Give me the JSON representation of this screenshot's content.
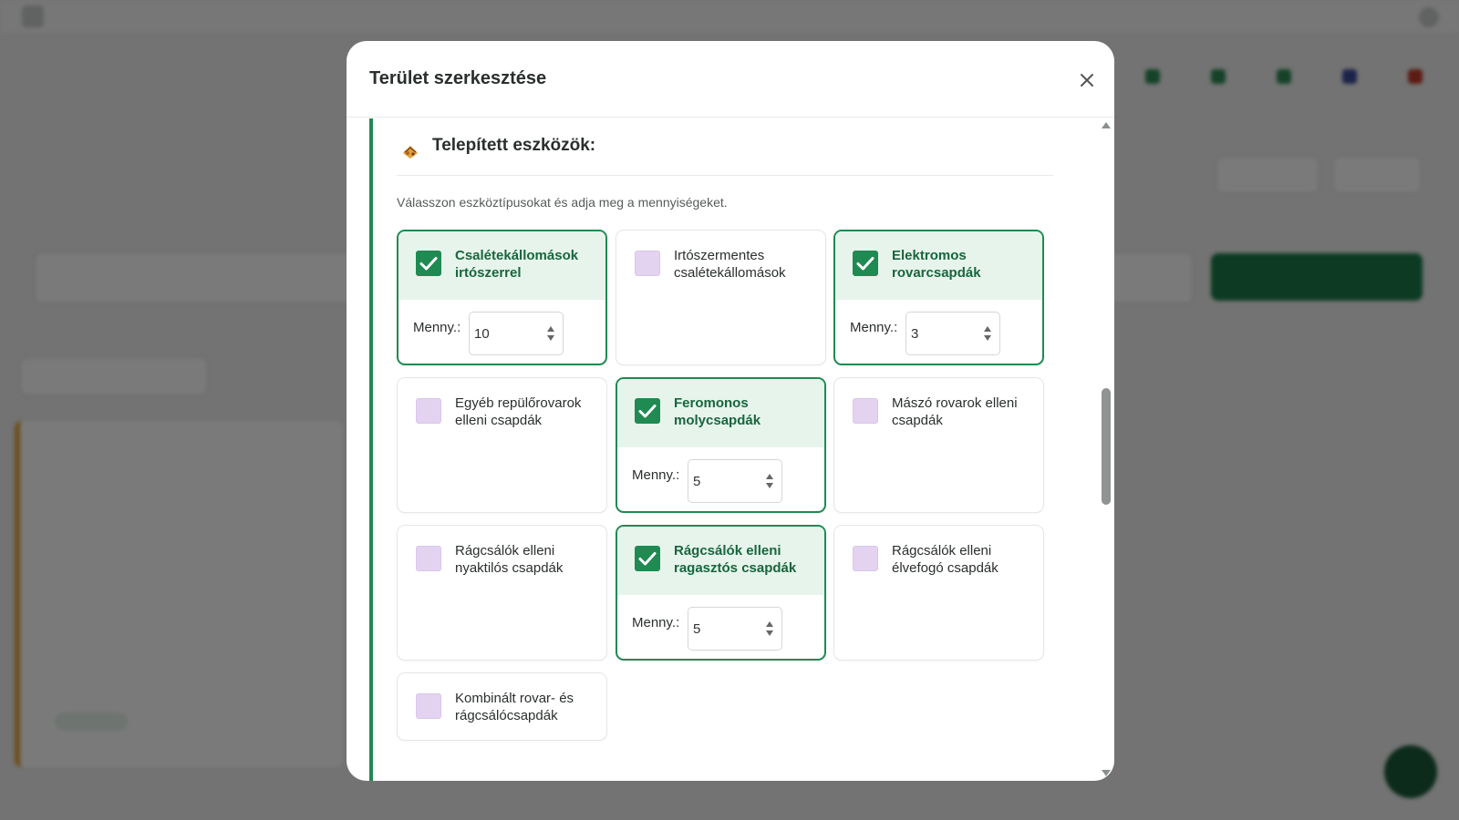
{
  "modal": {
    "title": "Terület szerkesztése",
    "close_icon": "close-icon"
  },
  "section": {
    "icon": "mouse-trap-icon",
    "title": "Telepített eszközök:",
    "description": "Válasszon eszköztípusokat és adja meg a mennyiségeket."
  },
  "qty_label": "Menny.:",
  "devices": [
    {
      "label": "Csalétekállomások irtószerrel",
      "checked": true,
      "quantity": "10"
    },
    {
      "label": "Irtószermentes csalétekállomások",
      "checked": false
    },
    {
      "label": "Elektromos rovarcsapdák",
      "checked": true,
      "quantity": "3"
    },
    {
      "label": "Egyéb repülőrovarok elleni csapdák",
      "checked": false
    },
    {
      "label": "Feromonos molycsapdák",
      "checked": true,
      "quantity": "5"
    },
    {
      "label": "Mászó rovarok elleni csapdák",
      "checked": false
    },
    {
      "label": "Rágcsálók elleni nyaktilós csapdák",
      "checked": false
    },
    {
      "label": "Rágcsálók elleni ragasztós csapdák",
      "checked": true,
      "quantity": "5"
    },
    {
      "label": "Rágcsálók elleni élvefogó csapdák",
      "checked": false
    },
    {
      "label": "Kombinált rovar- és rágcsálócsapdák",
      "checked": false
    }
  ],
  "colors": {
    "accent": "#1f8a52",
    "checked_bg": "#e7f4ec",
    "unchecked_box": "#e3d3f0"
  }
}
